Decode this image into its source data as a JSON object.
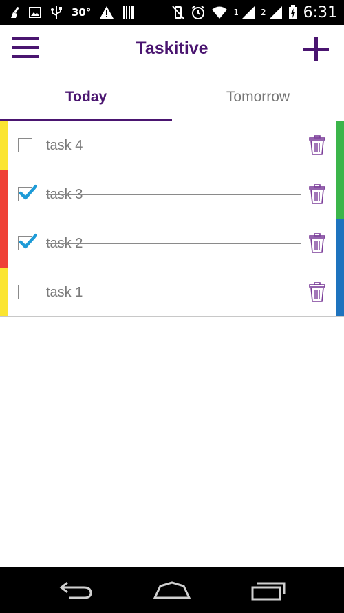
{
  "status_bar": {
    "temperature": "30°",
    "sim1": "1",
    "sim2": "2",
    "time": "6:31",
    "icons": [
      "broom-icon",
      "image-icon",
      "usb-icon",
      "warning-icon",
      "barcode-icon",
      "vibrate-off-icon",
      "alarm-icon",
      "wifi-icon",
      "signal-icon",
      "battery-charging-icon"
    ]
  },
  "app_bar": {
    "title": "Taskitive",
    "menu_icon": "hamburger-menu-icon",
    "add_icon": "plus-icon"
  },
  "tabs": [
    {
      "label": "Today",
      "active": true
    },
    {
      "label": "Tomorrow",
      "active": false
    }
  ],
  "tasks": [
    {
      "label": "task 4",
      "checked": false,
      "left_color": "#fbe531",
      "right_color": "#3bb54a"
    },
    {
      "label": "task 3",
      "checked": true,
      "left_color": "#ef4136",
      "right_color": "#3bb54a"
    },
    {
      "label": "task 2",
      "checked": true,
      "left_color": "#ef4136",
      "right_color": "#1e73be"
    },
    {
      "label": "task 1",
      "checked": false,
      "left_color": "#fbe531",
      "right_color": "#1e73be"
    }
  ],
  "colors": {
    "brand_purple": "#4a1570",
    "check_blue": "#1e9bd7"
  },
  "nav_bar": {
    "icons": [
      "back-icon",
      "home-icon",
      "recent-apps-icon"
    ]
  }
}
